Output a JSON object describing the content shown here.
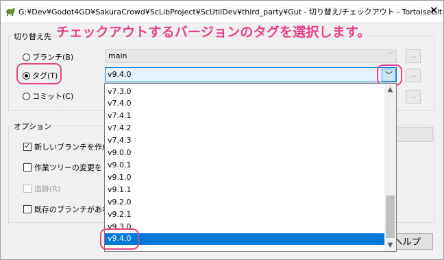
{
  "window": {
    "title": "G:¥Dev¥Godot4GD¥SakuraCrowd¥ScLibProject¥ScUtilDev¥third_party¥Gut - 切り替え/チェックアウト - TortoiseGit",
    "close_glyph": "✕"
  },
  "callout": "チェックアウトするバージョンのタグを選択します。",
  "switch_to": {
    "label": "切り替え先",
    "branch": {
      "label": "ブランチ(B)",
      "value": "main",
      "selected": false
    },
    "tag": {
      "label": "タグ(T)",
      "value": "v9.4.0",
      "selected": true
    },
    "commit": {
      "label": "コミット(C)",
      "selected": false
    },
    "ellipsis": "..."
  },
  "tag_dropdown": {
    "items": [
      "v7.3.0",
      "v7.4.0",
      "v7.4.1",
      "v7.4.2",
      "v7.4.3",
      "v9.0.0",
      "v9.0.1",
      "v9.1.0",
      "v9.1.1",
      "v9.2.0",
      "v9.2.1",
      "v9.3.0"
    ],
    "selected": "v9.4.0"
  },
  "options": {
    "label": "オプション",
    "new_branch": {
      "label": "新しいブランチを作成",
      "checked": true
    },
    "override_changes": {
      "label": "作業ツリーの変更を",
      "checked": false
    },
    "track": {
      "label": "追跡(R)",
      "checked": false,
      "disabled": true
    },
    "override_branch": {
      "label": "既存のブランチがあれ",
      "checked": false
    }
  },
  "buttons": {
    "help": "ヘルプ"
  },
  "colors": {
    "accent": "#e8418b",
    "selection": "#0078d7"
  }
}
